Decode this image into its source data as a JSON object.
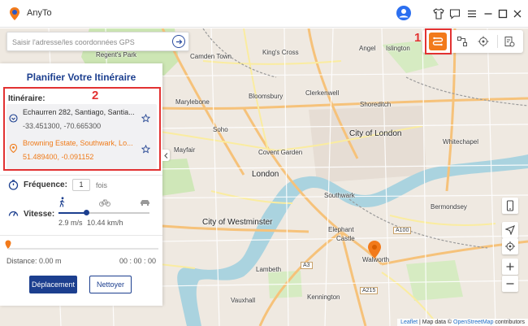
{
  "app": {
    "title": "AnyTo"
  },
  "search": {
    "placeholder": "Saisir l'adresse/les coordonnées GPS"
  },
  "annotations": {
    "one": "1",
    "two": "2"
  },
  "panel": {
    "title": "Planifier Votre Itinéraire",
    "itinerary_label": "Itinéraire:",
    "stops": [
      {
        "address": "Echaurren 282, Santiago, Santia...",
        "coords": "-33.451300, -70.665300"
      },
      {
        "address": "Browning Estate, Southwark, Lo...",
        "coords": "51.489400, -0.091152"
      }
    ],
    "frequency_label": "Fréquence:",
    "frequency_value": "1",
    "frequency_unit": "fois",
    "speed_label": "Vitesse:",
    "speed_ms": "2.9 m/s",
    "speed_kmh": "10.44 km/h",
    "speed_fraction": 0.3,
    "progress_fraction": 0,
    "distance": "Distance: 0.00 m",
    "time": "00 : 00 : 00",
    "move_button": "Déplacement",
    "clear_button": "Nettoyer"
  },
  "map": {
    "labels": {
      "kings_cross": "King's Cross",
      "regents_park": "Regent's Park",
      "angel": "Angel",
      "islington": "Islington",
      "camden": "Camden Town",
      "marylebone": "Marylebone",
      "bloomsbury": "Bloomsbury",
      "clerkenwell": "Clerkenwell",
      "shoreditch": "Shoreditch",
      "city": "City of London",
      "covent": "Covent Garden",
      "london": "London",
      "mayfair": "Mayfair",
      "soho": "Soho",
      "southwark": "Southwark",
      "westminster": "City of Westminster",
      "lambeth": "Lambeth",
      "elephant": "Elephant",
      "castle": "Castle",
      "walworth": "Walworth",
      "vauxhall": "Vauxhall",
      "kennington": "Kennington",
      "whitechapel": "Whitechapel",
      "bermondsey": "Bermondsey",
      "a100": "A100",
      "a215": "A215",
      "a3": "A3"
    },
    "attribution": {
      "leaflet": "Leaflet",
      "sep": " | Map data © ",
      "osm": "OpenStreetMap",
      "rest": " contributors"
    }
  },
  "colors": {
    "accent": "#f27a1a",
    "primary": "#1c3f8f",
    "annotation": "#e23232"
  }
}
